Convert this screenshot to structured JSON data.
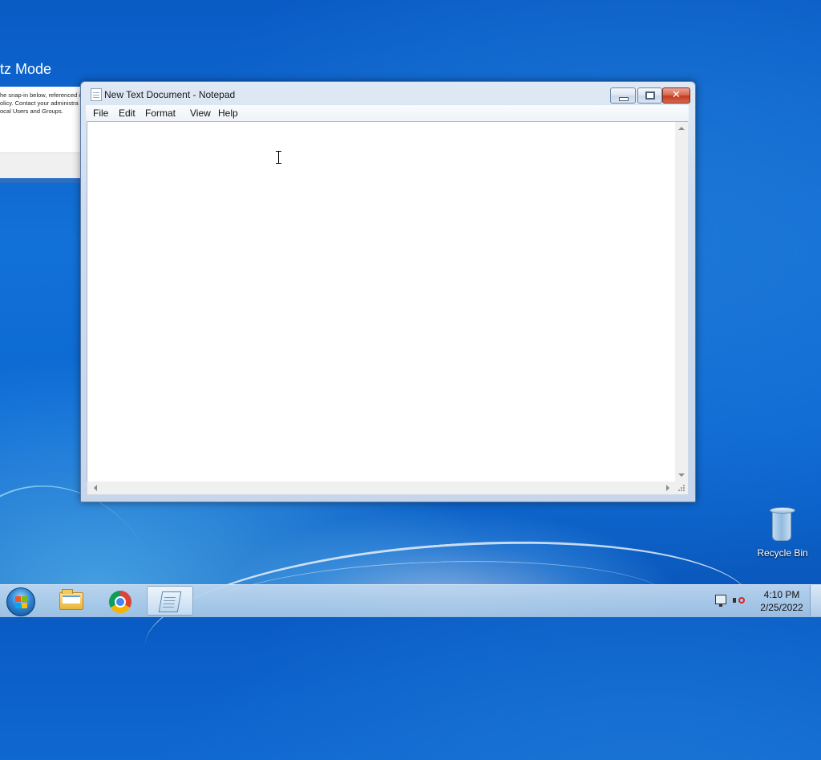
{
  "background_window": {
    "title": "tz Mode",
    "text_lines": [
      "he snap-in below, referenced i",
      "olicy. Contact your administra",
      "ocal Users and Groups."
    ]
  },
  "notepad": {
    "title": "New Text Document - Notepad",
    "icon": "notepad-icon",
    "menu": [
      "File",
      "Edit",
      "Format",
      "View",
      "Help"
    ],
    "content": "",
    "controls": {
      "minimize": "minimize-icon",
      "maximize": "maximize-icon",
      "close_glyph": "✕"
    }
  },
  "desktop_icons": [
    {
      "label": "Recycle Bin",
      "icon": "recycle-bin-icon"
    }
  ],
  "taskbar": {
    "start": "windows-start-icon",
    "pinned": [
      {
        "name": "Windows Explorer",
        "icon": "folder-icon",
        "active": false
      },
      {
        "name": "Google Chrome",
        "icon": "chrome-icon",
        "active": false
      },
      {
        "name": "Notepad",
        "icon": "notepad-icon",
        "active": true
      }
    ],
    "tray": {
      "icons": [
        "network-icon",
        "volume-muted-icon"
      ]
    },
    "clock": {
      "time": "4:10 PM",
      "date": "2/25/2022"
    }
  },
  "colors": {
    "wallpaper": "#1271d8",
    "close_button": "#c4391f",
    "taskbar": "#a8c8e8"
  }
}
